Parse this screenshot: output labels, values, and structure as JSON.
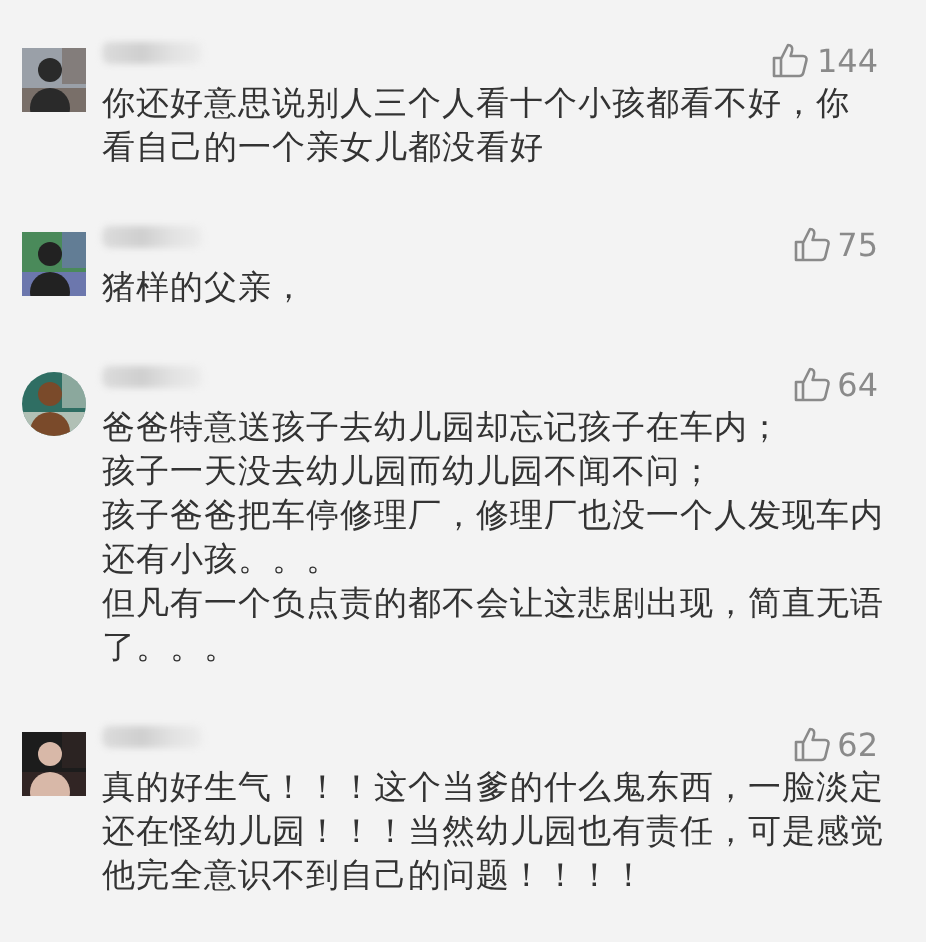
{
  "comments": [
    {
      "avatar": {
        "kind": "picture"
      },
      "likes": "144",
      "lines": [
        "你还好意思说别人三个人看十个小孩都看不好，你",
        "看自己的一个亲女儿都没看好"
      ]
    },
    {
      "avatar": {
        "kind": "picture"
      },
      "likes": "75",
      "lines": [
        "猪样的父亲，"
      ]
    },
    {
      "avatar": {
        "kind": "picture"
      },
      "likes": "64",
      "lines": [
        "爸爸特意送孩子去幼儿园却忘记孩子在车内；",
        "孩子一天没去幼儿园而幼儿园不闻不问；",
        "孩子爸爸把车停修理厂，修理厂也没一个人发现车内还有小孩。。。",
        "但凡有一个负点责的都不会让这悲剧出现，简直无语了。。。"
      ]
    },
    {
      "avatar": {
        "kind": "picture"
      },
      "likes": "62",
      "lines": [
        "真的好生气！！！这个当爹的什么鬼东西，一脸淡定还在怪幼儿园！！！当然幼儿园也有责任，可是感觉他完全意识不到自己的问题！！！！"
      ]
    }
  ]
}
